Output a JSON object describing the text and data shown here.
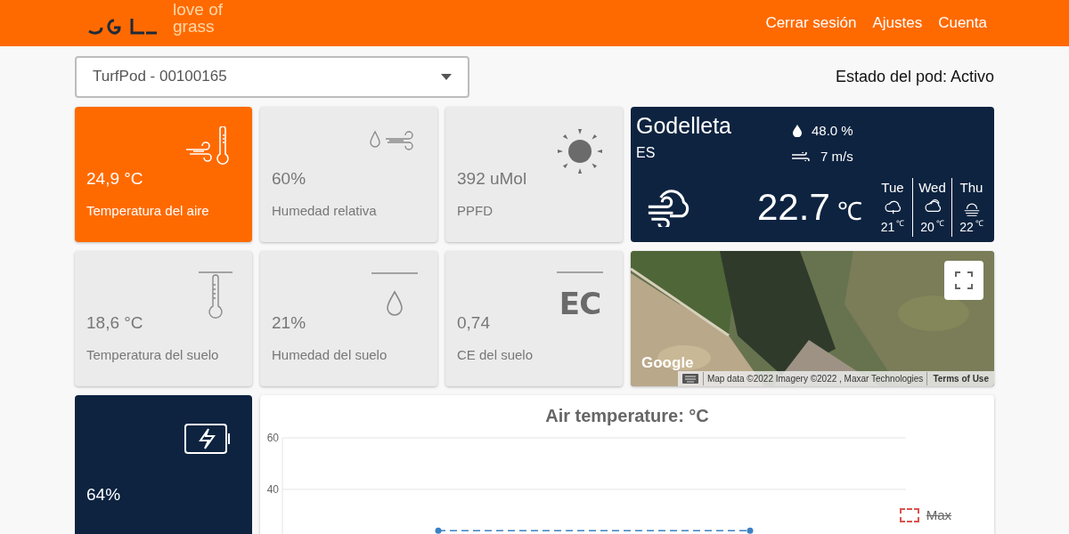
{
  "header": {
    "tagline": [
      "love of",
      "grass"
    ],
    "nav": [
      "Cerrar sesión",
      "Ajustes",
      "Cuenta"
    ]
  },
  "pod_select": {
    "value": "TurfPod - 00100165"
  },
  "pod_status": "Estado del pod: Activo",
  "sensors": [
    {
      "kind": "air-temp",
      "value": "24,9 °C",
      "label": "Temperatura del aire",
      "selected": true
    },
    {
      "kind": "air-humidity",
      "value": "60%",
      "label": "Humedad relativa",
      "selected": false
    },
    {
      "kind": "sun",
      "value": "392 uMol",
      "label": "PPFD",
      "selected": false
    },
    {
      "kind": "soil-temp",
      "value": "18,6 °C",
      "label": "Temperatura del suelo",
      "selected": false
    },
    {
      "kind": "soil-drop",
      "value": "21%",
      "label": "Humedad del suelo",
      "selected": false
    },
    {
      "kind": "ec",
      "icon_text": "EC",
      "value": "0,74",
      "label": "CE del suelo",
      "selected": false
    }
  ],
  "weather": {
    "city": "Godelleta",
    "country": "ES",
    "humidity": "48.0 %",
    "wind": "7 m/s",
    "temp": "22.7",
    "unit": "℃",
    "forecast": [
      {
        "day": "Tue",
        "kind": "rain",
        "temp": "21",
        "unit": "℃"
      },
      {
        "day": "Wed",
        "kind": "clouds",
        "temp": "20",
        "unit": "℃"
      },
      {
        "day": "Thu",
        "kind": "fog",
        "temp": "22",
        "unit": "℃"
      }
    ]
  },
  "map": {
    "logo": "Google",
    "attribution": "Map data ©2022 Imagery ©2022 , Maxar Technologies",
    "terms": "Terms of Use"
  },
  "battery": {
    "value": "64%"
  },
  "chart": {
    "legend": [
      {
        "label": "Max",
        "color": "#d9534f",
        "on": false
      }
    ],
    "chart_data": {
      "type": "line",
      "title": "Air temperature: °C",
      "yticks": [
        40,
        60
      ],
      "ylim": [
        22,
        60
      ],
      "series": [
        {
          "color": "#3b82c4",
          "line_style": "dashed",
          "marker": "circle",
          "values": [
            24,
            24
          ]
        }
      ]
    }
  }
}
